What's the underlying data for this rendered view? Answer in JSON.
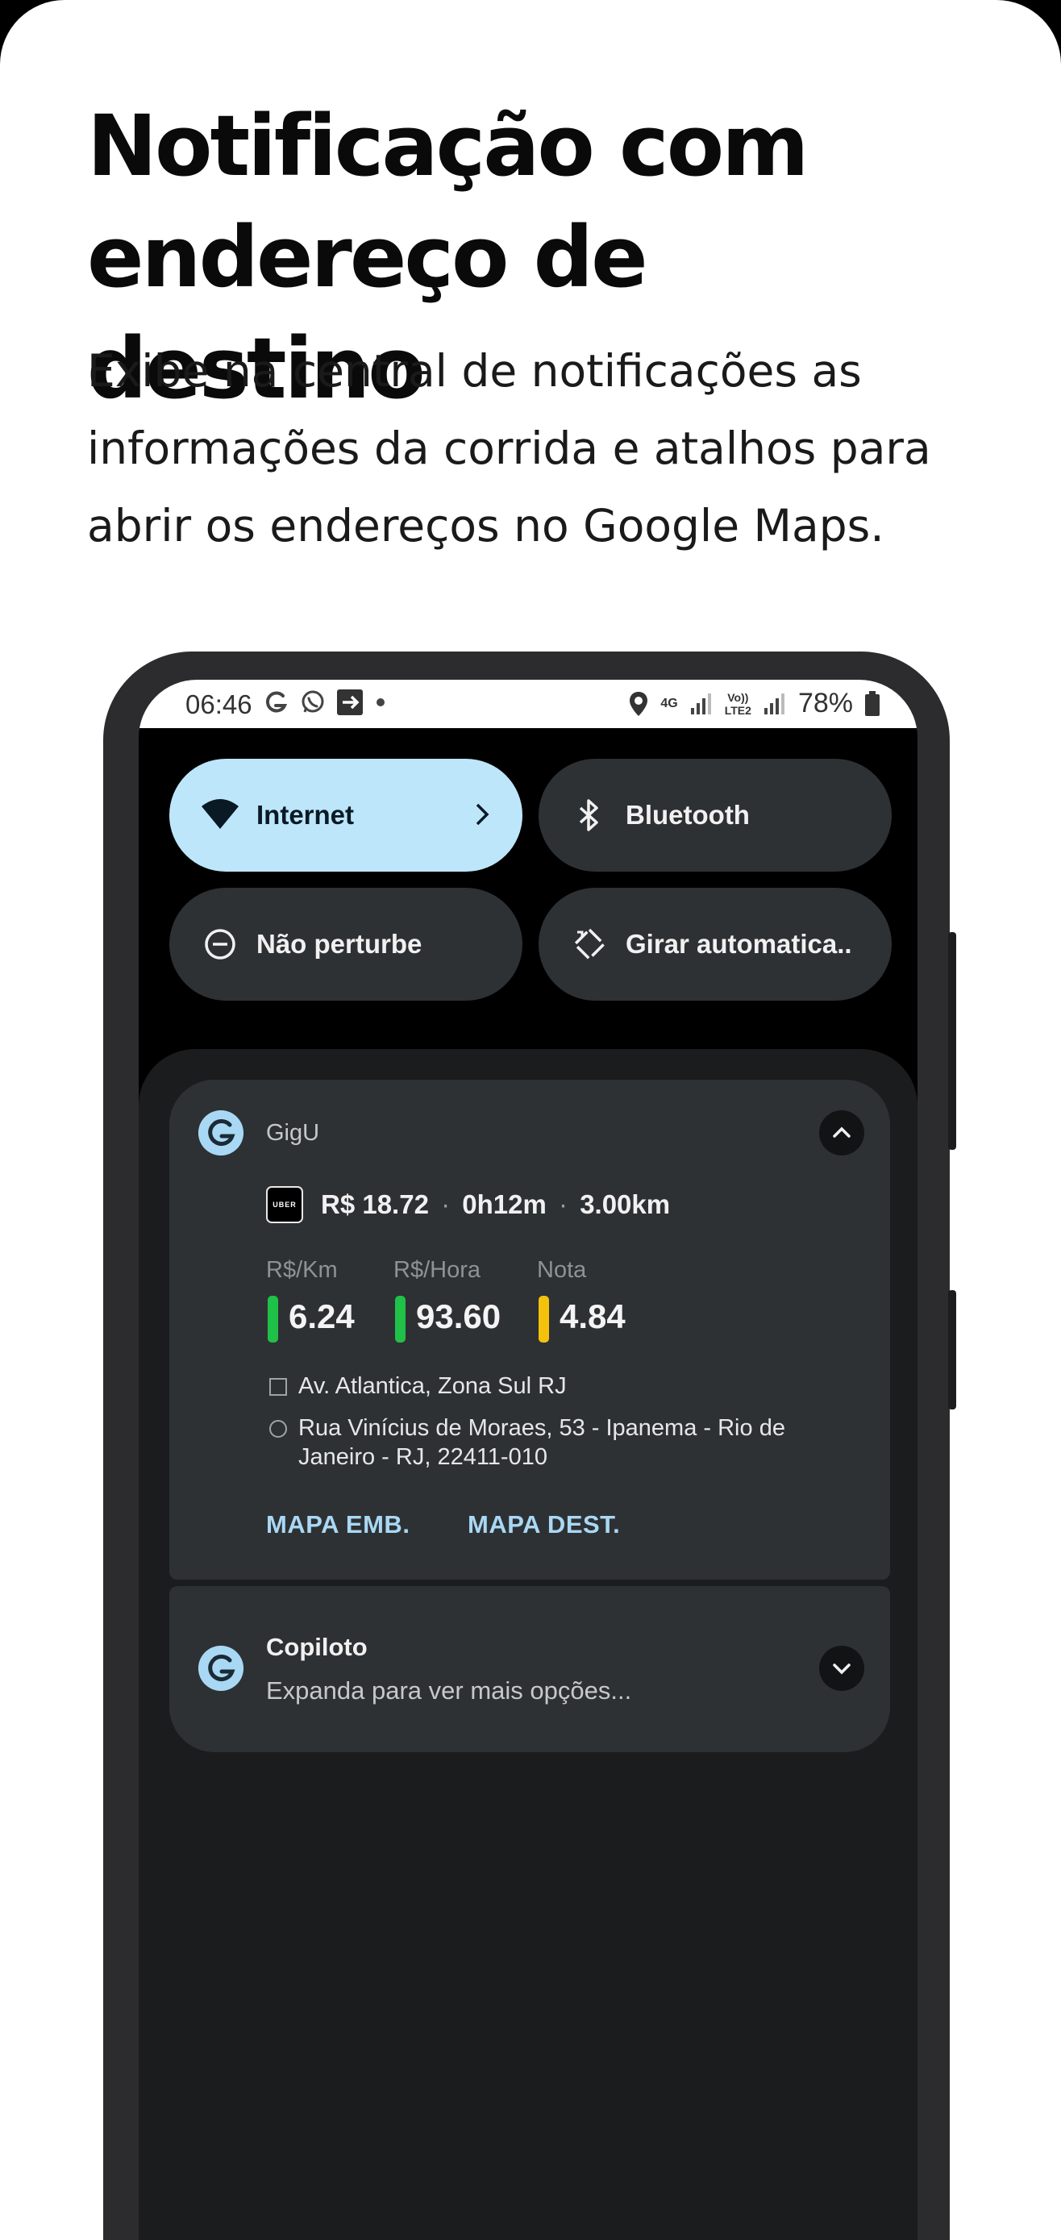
{
  "header": {
    "title_line1": "Notificação com",
    "title_line2": "endereço de destino",
    "subtitle_line1": "Exibe na central de notificações as",
    "subtitle_line2": "informações da corrida e atalhos para",
    "subtitle_line3": "abrir os endereços no Google Maps."
  },
  "statusbar": {
    "time": "06:46",
    "network": "4G",
    "volte_top": "Vo))",
    "volte_bottom": "LTE2",
    "battery": "78%"
  },
  "quick_settings": [
    {
      "label": "Internet",
      "icon": "wifi-icon",
      "active": true
    },
    {
      "label": "Bluetooth",
      "icon": "bluetooth-icon",
      "active": false
    },
    {
      "label": "Não perturbe",
      "icon": "do-not-disturb-icon",
      "active": false
    },
    {
      "label": "Girar automatica..",
      "icon": "auto-rotate-icon",
      "active": false
    }
  ],
  "notification_gigu": {
    "app_name": "GigU",
    "service_logo_text": "UBER",
    "fare": "R$ 18.72",
    "duration": "0h12m",
    "distance": "3.00km",
    "separator": "·",
    "metrics": [
      {
        "label": "R$/Km",
        "value": "6.24",
        "color": "#1fc148"
      },
      {
        "label": "R$/Hora",
        "value": "93.60",
        "color": "#1fc148"
      },
      {
        "label": "Nota",
        "value": "4.84",
        "color": "#f4c20d"
      }
    ],
    "pickup": "Av. Atlantica, Zona Sul RJ",
    "destination_line1": "Rua Vinícius de Moraes, 53 - Ipanema - Rio de",
    "destination_line2": "Janeiro - RJ, 22411-010",
    "action_pickup_map": "MAPA EMB.",
    "action_destination_map": "MAPA DEST."
  },
  "notification_copiloto": {
    "title": "Copiloto",
    "subtitle": "Expanda para ver mais opções..."
  },
  "colors": {
    "accent": "#a9d8f4",
    "active_tile": "#bde6fb",
    "good": "#1fc148",
    "warning": "#f4c20d"
  }
}
